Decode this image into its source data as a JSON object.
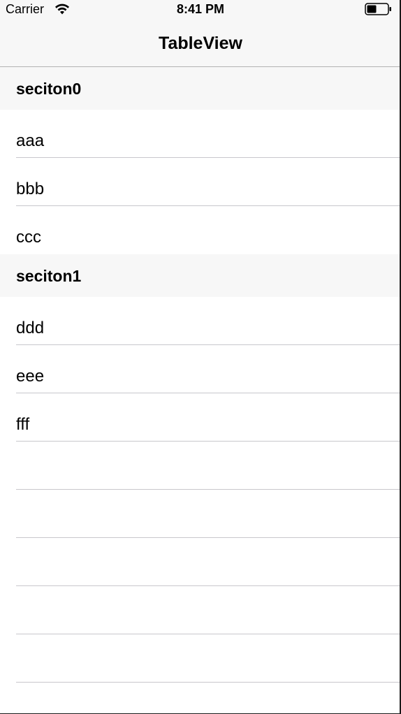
{
  "status_bar": {
    "carrier": "Carrier",
    "time": "8:41 PM",
    "icons": [
      "wifi-icon",
      "battery-icon"
    ]
  },
  "nav": {
    "title": "TableView"
  },
  "sections": [
    {
      "header": "seciton0",
      "rows": [
        "aaa",
        "bbb",
        "ccc"
      ]
    },
    {
      "header": "seciton1",
      "rows": [
        "ddd",
        "eee",
        "fff"
      ]
    }
  ],
  "colors": {
    "bar_background": "#f7f7f7",
    "separator": "#c8c7cc"
  }
}
